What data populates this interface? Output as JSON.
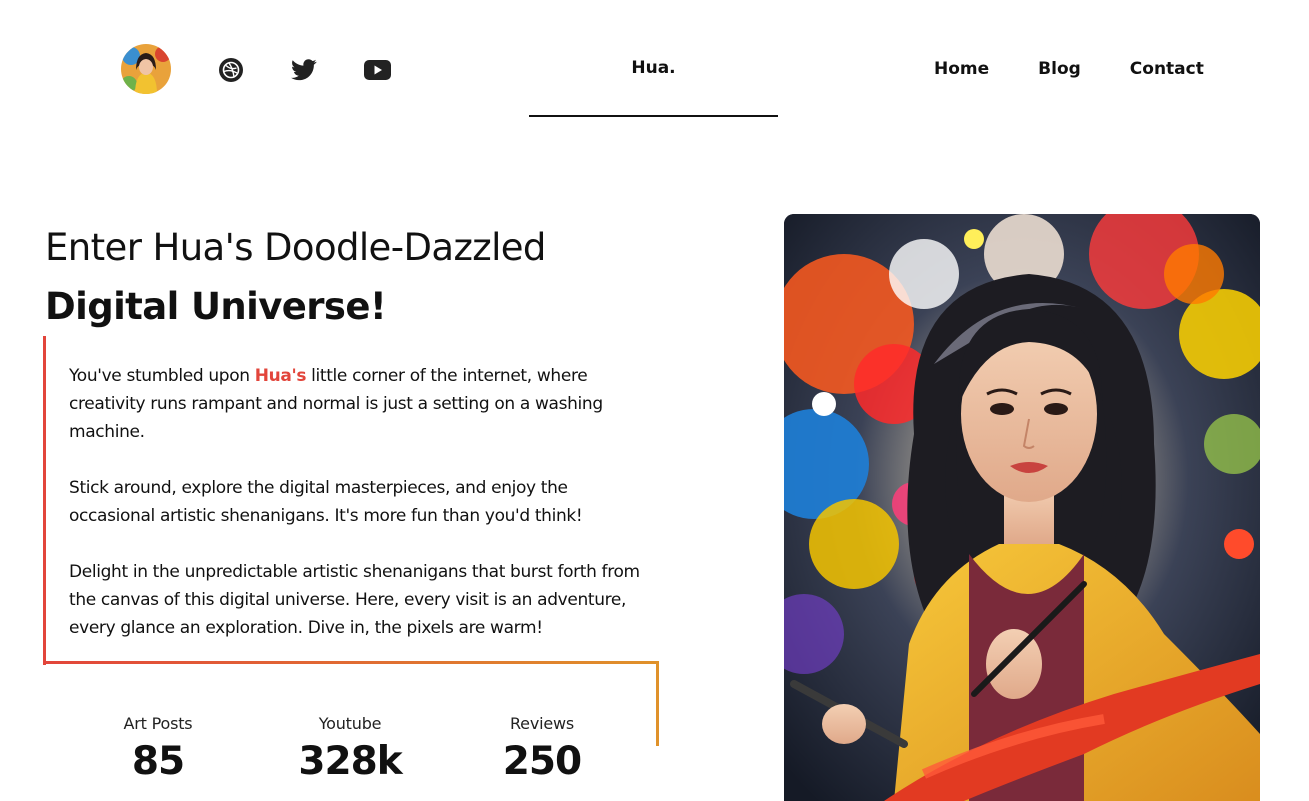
{
  "header": {
    "avatar_alt": "Hua avatar",
    "social": [
      {
        "icon": "dribbble-icon"
      },
      {
        "icon": "twitter-icon"
      },
      {
        "icon": "youtube-icon"
      }
    ],
    "brand": "Hua.",
    "nav": [
      {
        "label": "Home"
      },
      {
        "label": "Blog"
      },
      {
        "label": "Contact"
      }
    ]
  },
  "hero": {
    "title_line1": "Enter Hua's Doodle-Dazzled",
    "title_line2": "Digital Universe!",
    "p1_before": "You've stumbled upon ",
    "p1_highlight": "Hua's",
    "p1_after": " little corner of the internet, where creativity runs rampant and normal is just a setting on a washing machine.",
    "p2": "Stick around, explore the digital masterpieces, and enjoy the occasional artistic shenanigans. It's more fun than you'd think!",
    "p3": "Delight in the unpredictable artistic shenanigans that burst forth from the canvas of this digital universe. Here, every visit is an adventure, every glance an exploration. Dive in, the pixels are warm!"
  },
  "stats": [
    {
      "label": "Art Posts",
      "value": "85"
    },
    {
      "label": "Youtube",
      "value": "328k"
    },
    {
      "label": "Reviews",
      "value": "250"
    }
  ],
  "colors": {
    "accent_red": "#e2453b",
    "accent_orange": "#e0922a",
    "text": "#111111"
  }
}
